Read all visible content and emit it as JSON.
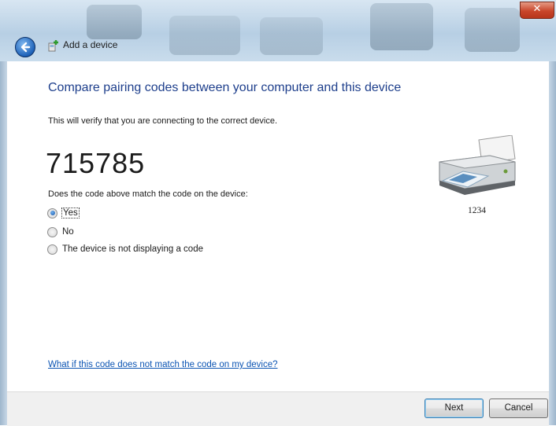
{
  "window": {
    "title": "Add a device",
    "close_label": "✕"
  },
  "main": {
    "heading": "Compare pairing codes between your computer and this device",
    "subtext": "This will verify that you are connecting to the correct device.",
    "pairing_code": "715785",
    "question": "Does the code above match the code on the device:",
    "options": [
      {
        "label": "Yes",
        "selected": true
      },
      {
        "label": "No",
        "selected": false
      },
      {
        "label": "The device is not displaying a code",
        "selected": false
      }
    ],
    "device": {
      "label": "1234",
      "icon": "printer-icon"
    },
    "help_link": "What if this code does not match the code on my device?"
  },
  "footer": {
    "next_label": "Next",
    "cancel_label": "Cancel"
  }
}
